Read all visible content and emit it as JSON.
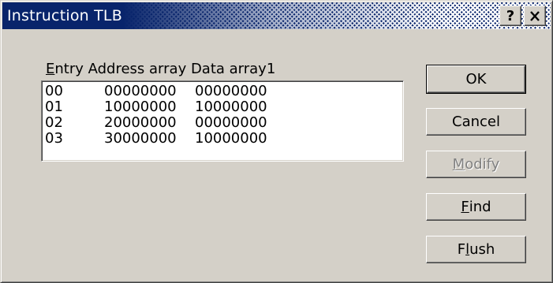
{
  "window": {
    "title": "Instruction TLB"
  },
  "title_buttons": {
    "help": "?",
    "close_icon": "close-icon"
  },
  "list": {
    "header": {
      "mnemonic": "E",
      "rest": "ntry Address array Data array1"
    },
    "rows": [
      {
        "entry": "00",
        "address": "00000000",
        "data": "00000000"
      },
      {
        "entry": "01",
        "address": "10000000",
        "data": "10000000"
      },
      {
        "entry": "02",
        "address": "20000000",
        "data": "00000000"
      },
      {
        "entry": "03",
        "address": "30000000",
        "data": "10000000"
      }
    ]
  },
  "buttons": {
    "ok": "OK",
    "cancel": "Cancel",
    "modify": {
      "mnemonic": "M",
      "rest": "odify",
      "disabled": true
    },
    "find": {
      "mnemonic": "F",
      "rest": "ind"
    },
    "flush": {
      "pre": "F",
      "mnemonic": "l",
      "rest": "ush"
    }
  }
}
